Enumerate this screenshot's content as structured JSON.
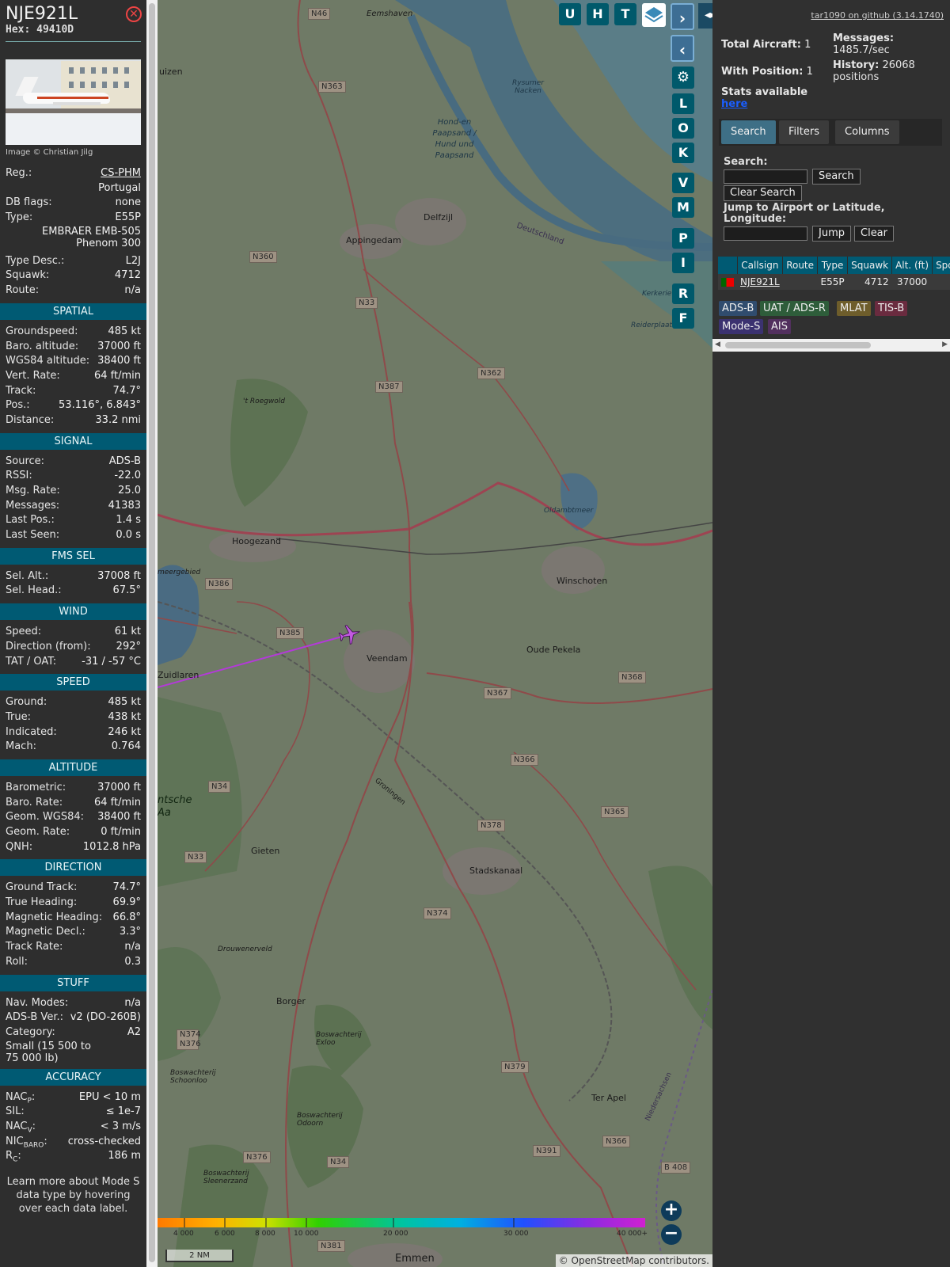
{
  "info": {
    "callsign": "NJE921L",
    "hex": "Hex: 49410D",
    "photo_credit": "Image © Christian Jilg",
    "top_rows": [
      {
        "k": "Reg.:",
        "v": "CS-PHM",
        "link": true
      },
      {
        "k": "",
        "v": "Portugal"
      },
      {
        "k": "DB flags:",
        "v": "none"
      },
      {
        "k": "Type:",
        "v": "E55P"
      }
    ],
    "type_desc_lines": [
      "EMBRAER EMB-505",
      "Phenom 300"
    ],
    "top_rows2": [
      {
        "k": "Type Desc.:",
        "v": "L2J"
      },
      {
        "k": "Squawk:",
        "v": "4712"
      },
      {
        "k": "Route:",
        "v": "n/a"
      }
    ],
    "sections": [
      {
        "title": "SPATIAL",
        "rows": [
          {
            "k": "Groundspeed:",
            "v": "485 kt"
          },
          {
            "k": "Baro. altitude:",
            "v": "37000 ft"
          },
          {
            "k": "WGS84 altitude:",
            "v": "38400 ft"
          },
          {
            "k": "Vert. Rate:",
            "v": "64 ft/min"
          },
          {
            "k": "Track:",
            "v": "74.7°"
          },
          {
            "k": "Pos.:",
            "v": "53.116°, 6.843°"
          },
          {
            "k": "Distance:",
            "v": "33.2 nmi"
          }
        ]
      },
      {
        "title": "SIGNAL",
        "rows": [
          {
            "k": "Source:",
            "v": "ADS-B"
          },
          {
            "k": "RSSI:",
            "v": "-22.0"
          },
          {
            "k": "Msg. Rate:",
            "v": "25.0"
          },
          {
            "k": "Messages:",
            "v": "41383"
          },
          {
            "k": "Last Pos.:",
            "v": "1.4 s"
          },
          {
            "k": "Last Seen:",
            "v": "0.0 s"
          }
        ]
      },
      {
        "title": "FMS SEL",
        "rows": [
          {
            "k": "Sel. Alt.:",
            "v": "37008 ft"
          },
          {
            "k": "Sel. Head.:",
            "v": "67.5°"
          }
        ]
      },
      {
        "title": "WIND",
        "rows": [
          {
            "k": "Speed:",
            "v": "61 kt"
          },
          {
            "k": "Direction (from):",
            "v": "292°"
          },
          {
            "k": "TAT / OAT:",
            "v": "-31 / -57 °C"
          }
        ]
      },
      {
        "title": "SPEED",
        "rows": [
          {
            "k": "Ground:",
            "v": "485 kt"
          },
          {
            "k": "True:",
            "v": "438 kt"
          },
          {
            "k": "Indicated:",
            "v": "246 kt"
          },
          {
            "k": "Mach:",
            "v": "0.764"
          }
        ]
      },
      {
        "title": "ALTITUDE",
        "rows": [
          {
            "k": "Barometric:",
            "v": "37000 ft"
          },
          {
            "k": "Baro. Rate:",
            "v": "64 ft/min"
          },
          {
            "k": "Geom. WGS84:",
            "v": "38400 ft"
          },
          {
            "k": "Geom. Rate:",
            "v": "0 ft/min"
          },
          {
            "k": "QNH:",
            "v": "1012.8 hPa"
          }
        ]
      },
      {
        "title": "DIRECTION",
        "rows": [
          {
            "k": "Ground Track:",
            "v": "74.7°"
          },
          {
            "k": "True Heading:",
            "v": "69.9°"
          },
          {
            "k": "Magnetic Heading:",
            "v": "66.8°"
          },
          {
            "k": "Magnetic Decl.:",
            "v": "3.3°"
          },
          {
            "k": "Track Rate:",
            "v": "n/a"
          },
          {
            "k": "Roll:",
            "v": "0.3"
          }
        ]
      },
      {
        "title": "STUFF",
        "rows": [
          {
            "k": "Nav. Modes:",
            "v": "n/a"
          },
          {
            "k": "ADS-B Ver.:",
            "v": "v2 (DO-260B)"
          },
          {
            "k": "Category:",
            "v": "A2"
          }
        ],
        "note": "Small (15 500 to 75 000 lb)"
      },
      {
        "title": "ACCURACY",
        "rows": [
          {
            "k": "NAC",
            "sub": "P",
            "v": "EPU < 10 m"
          },
          {
            "k": "SIL:",
            "v": "≤ 1e-7"
          },
          {
            "k": "NAC",
            "sub": "V",
            "v": "< 3 m/s"
          },
          {
            "k": "NIC",
            "sub": "BARO",
            "v": "cross-checked"
          },
          {
            "k": "R",
            "sub": "C",
            "v": "186 m"
          }
        ]
      }
    ],
    "learn_more": "Learn more about Mode S data type by hovering over each data label."
  },
  "map": {
    "top_buttons": [
      "U",
      "H",
      "T"
    ],
    "side_buttons": [
      "L",
      "O",
      "K",
      "V",
      "M",
      "P",
      "I",
      "R",
      "F"
    ],
    "places": [
      {
        "name": "Eemshaven"
      },
      {
        "name": "uizen"
      },
      {
        "name": "Delfzijl"
      },
      {
        "name": "Appingedam"
      },
      {
        "name": "Hoogezand"
      },
      {
        "name": "Winschoten"
      },
      {
        "name": "Veendam"
      },
      {
        "name": "Oude Pekela"
      },
      {
        "name": "Zuidlaren"
      },
      {
        "name": "Gieten"
      },
      {
        "name": "Stadskanaal"
      },
      {
        "name": "Borger"
      },
      {
        "name": "Ter Apel"
      },
      {
        "name": "Emmen"
      },
      {
        "name": "Hond-en Paapsand / Hund und Paapsand"
      },
      {
        "name": "Rysumer Nacken"
      },
      {
        "name": "Oldambtmeer"
      },
      {
        "name": "Drouwenerveld"
      },
      {
        "name": "Boswachterij Exloo"
      },
      {
        "name": "Boswachterij Odoorn"
      },
      {
        "name": "Boswachterij Schoonloo"
      },
      {
        "name": "Boswachterij Sleenerzand"
      },
      {
        "name": "'t Roegwold"
      },
      {
        "name": "Reiderplaat"
      },
      {
        "name": "Kerkeriet"
      },
      {
        "name": "Deutschland"
      },
      {
        "name": "Groningen"
      },
      {
        "name": "Niedersachsen"
      },
      {
        "name": "ntsche Aa"
      },
      {
        "name": "meergebied"
      }
    ],
    "roads": [
      "N46",
      "N363",
      "N360",
      "N33",
      "N387",
      "N362",
      "N386",
      "N385",
      "N367",
      "N368",
      "N366",
      "N34",
      "N378",
      "N365",
      "N33",
      "N374",
      "N379",
      "N374 N376",
      "N391",
      "N366",
      "N376",
      "N34",
      "N381",
      "B 408"
    ],
    "legend_ticks": [
      "4 000",
      "6 000",
      "8 000",
      "10 000",
      "20 000",
      "30 000",
      "40 000+"
    ],
    "scale": "2 NM",
    "attribution": "© OpenStreetMap contributors."
  },
  "sidebar": {
    "github": "tar1090 on github (3.14.1740)",
    "total_aircraft_label": "Total Aircraft:",
    "total_aircraft": "1",
    "with_position_label": "With Position:",
    "with_position": "1",
    "messages_label": "Messages:",
    "messages_value": "1485.7/sec",
    "history_label": "History:",
    "history_value": "26068 positions",
    "stats_label": "Stats available",
    "stats_link": "here",
    "tabs": [
      "Search",
      "Filters",
      "Columns"
    ],
    "search_label": "Search:",
    "search_button": "Search",
    "clear_search_button": "Clear Search",
    "jump_label": "Jump to Airport or Latitude, Longitude:",
    "jump_button": "Jump",
    "clear_button": "Clear",
    "table_headers": [
      "",
      "Callsign",
      "Route",
      "Type",
      "Squawk",
      "Alt. (ft)",
      "Spd."
    ],
    "table_rows": [
      {
        "callsign": "NJE921L",
        "route": "",
        "type": "E55P",
        "squawk": "4712",
        "alt": "37000",
        "spd": ""
      }
    ],
    "sources": [
      "ADS-B",
      "UAT / ADS-R",
      "MLAT",
      "TIS-B",
      "Mode-S",
      "AIS"
    ]
  },
  "colors": {
    "header_teal": "#005a73",
    "track_line": "#b33ad8",
    "aircraft": "#c25be0"
  }
}
